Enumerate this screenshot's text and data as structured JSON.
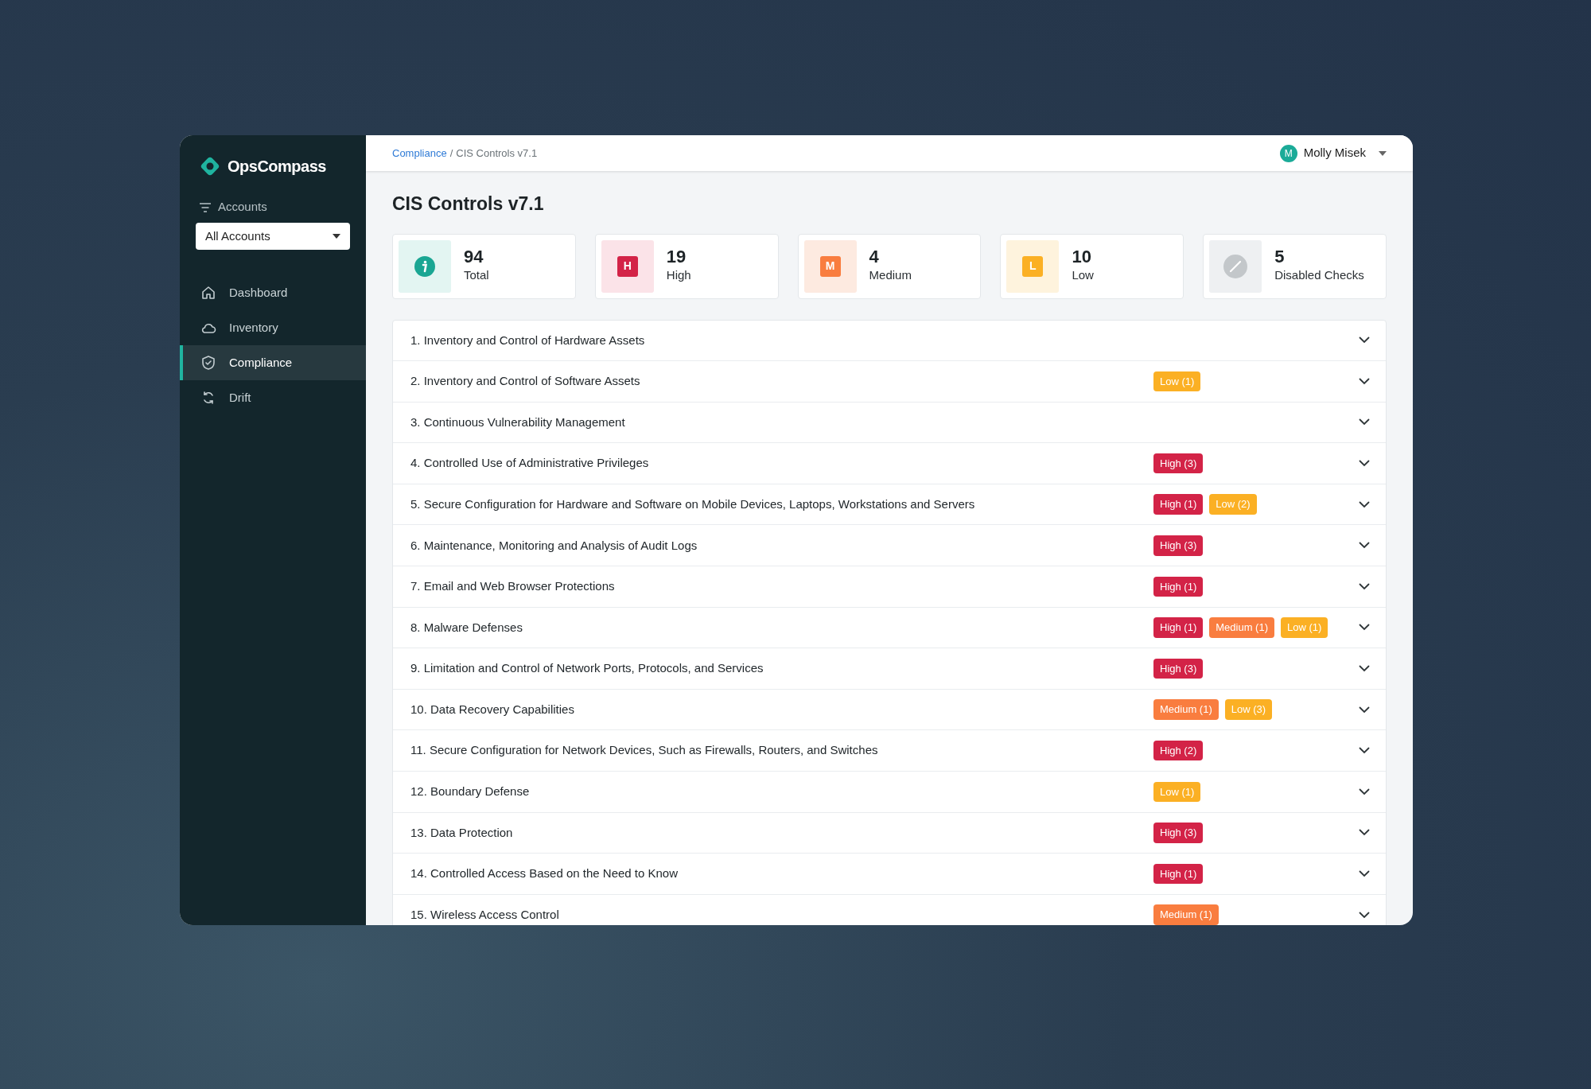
{
  "sidebar": {
    "brand": "OpsCompass",
    "filter_label": "Accounts",
    "account_select": "All Accounts",
    "items": [
      {
        "label": "Dashboard",
        "selected": false
      },
      {
        "label": "Inventory",
        "selected": false
      },
      {
        "label": "Compliance",
        "selected": true
      },
      {
        "label": "Drift",
        "selected": false
      }
    ]
  },
  "header": {
    "breadcrumb_separator": "/",
    "breadcrumb": [
      {
        "label": "Compliance",
        "link": true
      },
      {
        "label": "CIS Controls v7.1",
        "link": false
      }
    ],
    "user": {
      "initial": "M",
      "name": "Molly Misek"
    }
  },
  "title": "CIS Controls v7.1",
  "stats": [
    {
      "kind": "info",
      "value": "94",
      "label": "Total"
    },
    {
      "kind": "high",
      "letter": "H",
      "value": "19",
      "label": "High"
    },
    {
      "kind": "medium",
      "letter": "M",
      "value": "4",
      "label": "Medium"
    },
    {
      "kind": "low",
      "letter": "L",
      "value": "10",
      "label": "Low"
    },
    {
      "kind": "disabled",
      "value": "5",
      "label": "Disabled Checks"
    }
  ],
  "controls": [
    {
      "title": "1. Inventory and Control of Hardware Assets"
    },
    {
      "title": "2. Inventory and Control of Software Assets",
      "badges": [
        {
          "kind": "low",
          "label": "Low (1)"
        }
      ]
    },
    {
      "title": "3. Continuous Vulnerability Management"
    },
    {
      "title": "4. Controlled Use of Administrative Privileges",
      "badges": [
        {
          "kind": "high",
          "label": "High (3)"
        }
      ]
    },
    {
      "title": "5. Secure Configuration for Hardware and Software on Mobile Devices, Laptops, Workstations and Servers",
      "badges": [
        {
          "kind": "high",
          "label": "High (1)"
        },
        {
          "kind": "low",
          "label": "Low (2)"
        }
      ]
    },
    {
      "title": "6. Maintenance, Monitoring and Analysis of Audit Logs",
      "badges": [
        {
          "kind": "high",
          "label": "High (3)"
        }
      ]
    },
    {
      "title": "7. Email and Web Browser Protections",
      "badges": [
        {
          "kind": "high",
          "label": "High (1)"
        }
      ]
    },
    {
      "title": "8. Malware Defenses",
      "badges": [
        {
          "kind": "high",
          "label": "High (1)"
        },
        {
          "kind": "medium",
          "label": "Medium (1)"
        },
        {
          "kind": "low",
          "label": "Low (1)"
        }
      ]
    },
    {
      "title": "9. Limitation and Control of Network Ports, Protocols, and Services",
      "badges": [
        {
          "kind": "high",
          "label": "High (3)"
        }
      ]
    },
    {
      "title": "10. Data Recovery Capabilities",
      "badges": [
        {
          "kind": "medium",
          "label": "Medium (1)"
        },
        {
          "kind": "low",
          "label": "Low (3)"
        }
      ]
    },
    {
      "title": "11. Secure Configuration for Network Devices, Such as Firewalls, Routers, and Switches",
      "badges": [
        {
          "kind": "high",
          "label": "High (2)"
        }
      ]
    },
    {
      "title": "12. Boundary Defense",
      "badges": [
        {
          "kind": "low",
          "label": "Low (1)"
        }
      ]
    },
    {
      "title": "13. Data Protection",
      "badges": [
        {
          "kind": "high",
          "label": "High (3)"
        }
      ]
    },
    {
      "title": "14. Controlled Access Based on the Need to Know",
      "badges": [
        {
          "kind": "high",
          "label": "High (1)"
        }
      ]
    },
    {
      "title": "15. Wireless Access Control",
      "badges": [
        {
          "kind": "medium",
          "label": "Medium (1)"
        }
      ]
    }
  ]
}
